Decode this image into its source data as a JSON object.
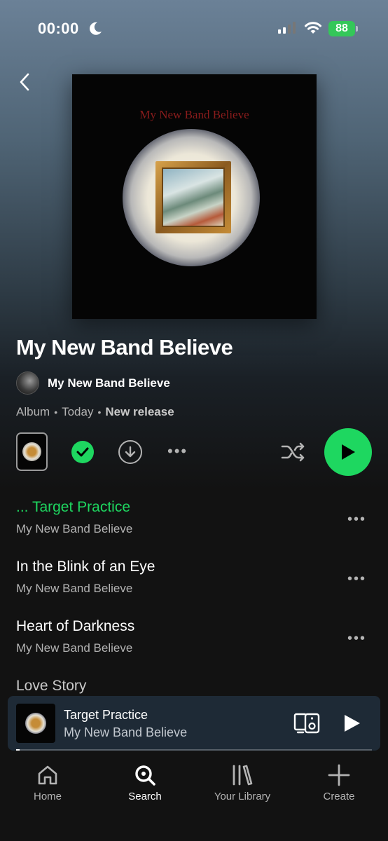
{
  "status": {
    "time": "00:00",
    "battery": "88"
  },
  "album": {
    "cover_text": "My New Band Believe",
    "title": "My New Band Believe",
    "artist": "My New Band Believe",
    "type": "Album",
    "date": "Today",
    "tag": "New release"
  },
  "colors": {
    "accent": "#1ed760",
    "background": "#121212",
    "secondary_text": "#b3b3b3"
  },
  "tracks": [
    {
      "title": "... Target Practice",
      "artist": "My New Band Believe",
      "playing": true
    },
    {
      "title": "In the Blink of an Eye",
      "artist": "My New Band Believe",
      "playing": false
    },
    {
      "title": "Heart of Darkness",
      "artist": "My New Band Believe",
      "playing": false
    },
    {
      "title": "Love Story",
      "artist": "",
      "playing": false
    }
  ],
  "now_playing": {
    "title": "Target Practice",
    "artist": "My New Band Believe",
    "progress": 0.01
  },
  "nav": {
    "home": "Home",
    "search": "Search",
    "library": "Your Library",
    "create": "Create"
  }
}
